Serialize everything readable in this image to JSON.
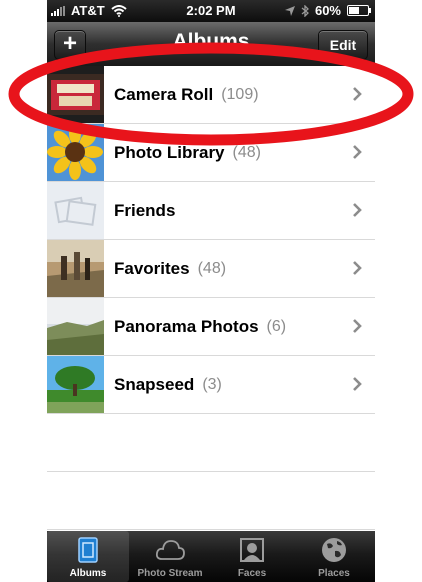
{
  "status_bar": {
    "carrier": "AT&T",
    "time": "2:02 PM",
    "battery": "60%",
    "battery_level": 0.6,
    "icons": [
      "signal-bars-icon",
      "wifi-icon",
      "location-arrow-icon",
      "bluetooth-icon",
      "battery-icon"
    ]
  },
  "nav_bar": {
    "title": "Albums",
    "add_label": "+",
    "edit_label": "Edit"
  },
  "albums": [
    {
      "name": "Camera Roll",
      "count": "(109)"
    },
    {
      "name": "Photo Library",
      "count": "(48)"
    },
    {
      "name": "Friends",
      "count": ""
    },
    {
      "name": "Favorites",
      "count": "(48)"
    },
    {
      "name": "Panorama Photos",
      "count": "(6)"
    },
    {
      "name": "Snapseed",
      "count": "(3)"
    }
  ],
  "tab_bar": {
    "tabs": [
      {
        "label": "Albums",
        "icon": "albums-icon",
        "active": true
      },
      {
        "label": "Photo Stream",
        "icon": "cloud-icon",
        "active": false
      },
      {
        "label": "Faces",
        "icon": "faces-icon",
        "active": false
      },
      {
        "label": "Places",
        "icon": "globe-icon",
        "active": false
      }
    ]
  },
  "colors": {
    "annotation_ellipse": "#e8141b",
    "chevron": "#8c8c8c",
    "count_text": "#8c8c8c"
  }
}
